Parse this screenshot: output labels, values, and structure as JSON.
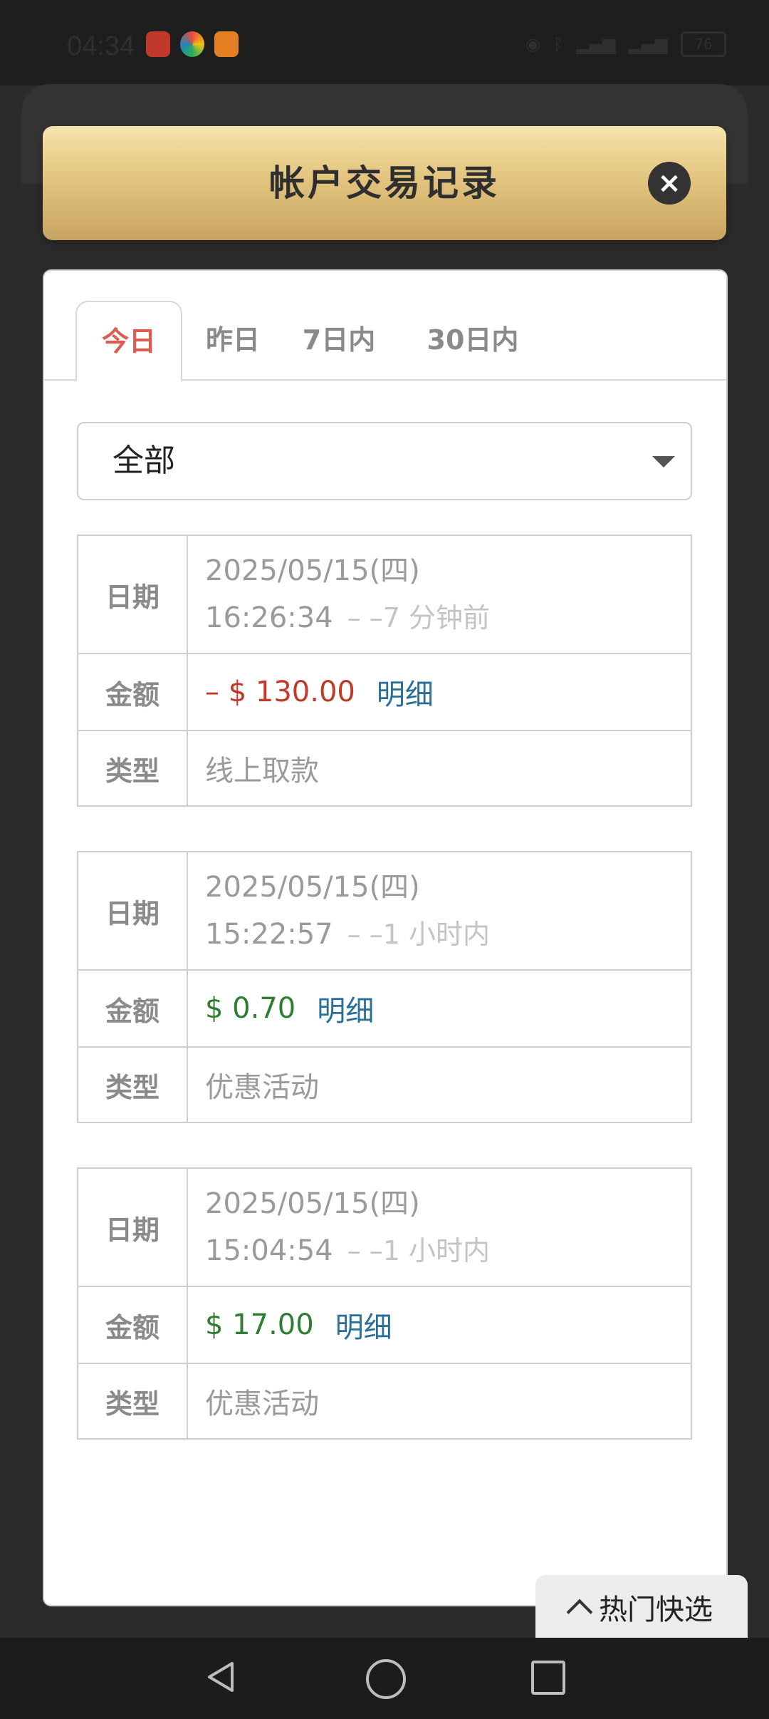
{
  "status_bar": {
    "time": "04:34",
    "battery": "76"
  },
  "dialog": {
    "title": "帐户交易记录",
    "close_symbol": "×"
  },
  "tabs": [
    {
      "label": "今日",
      "active": true
    },
    {
      "label": "昨日",
      "active": false
    },
    {
      "label": "7日内",
      "active": false
    },
    {
      "label": "30日内",
      "active": false
    }
  ],
  "filter": {
    "selected": "全部"
  },
  "labels": {
    "date": "日期",
    "amount": "金额",
    "type": "类型",
    "detail": "明细"
  },
  "records": [
    {
      "date": "2025/05/15(四)",
      "time": "16:26:34",
      "ago": "– –7 分钟前",
      "amount": "– $ 130.00",
      "amount_sign": "negative",
      "type": "线上取款"
    },
    {
      "date": "2025/05/15(四)",
      "time": "15:22:57",
      "ago": "– –1 小时内",
      "amount": "$ 0.70",
      "amount_sign": "positive",
      "type": "优惠活动"
    },
    {
      "date": "2025/05/15(四)",
      "time": "15:04:54",
      "ago": "– –1 小时内",
      "amount": "$ 17.00",
      "amount_sign": "positive",
      "type": "优惠活动"
    }
  ],
  "quick_select": {
    "label": "热门快选"
  },
  "colors": {
    "accent_red": "#e05a4f",
    "negative": "#c0392b",
    "positive": "#2e7d32",
    "link": "#2a6f97",
    "gold_top": "#f6e3ad",
    "gold_bottom": "#c7a461"
  },
  "icons": {
    "close": "close-icon",
    "dropdown": "chevron-down-icon",
    "quick": "chevron-up-icon",
    "nav_back": "back-icon",
    "nav_home": "home-icon",
    "nav_recent": "recent-apps-icon"
  }
}
